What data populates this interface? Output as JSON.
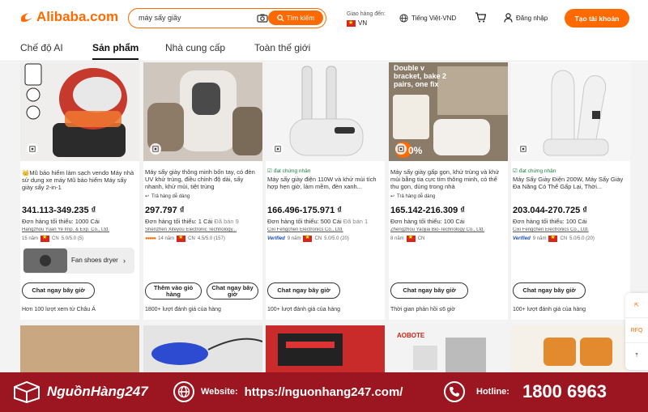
{
  "header": {
    "logo_text": "Alibaba.com",
    "search_query": "máy sấy giầy",
    "search_button": "Tìm kiếm",
    "deliver_to_label": "Giao hàng đến:",
    "deliver_to_country": "VN",
    "language": "Tiếng Việt-VND",
    "login": "Đăng nhập",
    "signup": "Tạo tài khoản"
  },
  "tabs": [
    "Chế độ AI",
    "Sản phẩm",
    "Nhà cung cấp",
    "Toàn thế giới"
  ],
  "products": [
    {
      "title": "👑Mũ bảo hiểm làm sạch vendo Máy nhà sử dụng xe máy Mũ bảo hiểm Máy sấy giày sấy 2-in-1",
      "price": "341.113-349.235 ₫",
      "moq": "Đơn hàng tối thiểu: 1000 Cái",
      "moq_sold": "",
      "supplier": "Hangzhou Yuan Ye Imp. & Exp. Co., Ltd.",
      "meta": "15 năm",
      "country": "CN",
      "rating": "5.0/5.0 (5)",
      "promo_title": "Fan shoes dryer",
      "chat": "Chat ngay bây giờ",
      "footer": "Hơn 100 lượt xem từ Châu Á"
    },
    {
      "title": "Máy sấy giày thông minh bốn tay, có đèn UV khử trùng, điều chỉnh độ dài, sấy nhanh, khử mùi, tiệt trùng",
      "feature": "Trả hàng dễ dàng",
      "price": "297.797 ₫",
      "moq": "Đơn hàng tối thiểu: 1 Cái",
      "moq_sold": "Đã bán 9",
      "supplier": "Shenzhen Xiteyou Electronic Technology...",
      "meta": "14 năm",
      "country": "CN",
      "rating": "4.5/5.0 (157)",
      "action1": "Thêm vào giỏ hàng",
      "action2": "Chat ngay bây giờ",
      "footer": "1800+ lượt đánh giá của hàng"
    },
    {
      "badge": "đạt chứng nhận",
      "title": "Máy sấy giày điện 110W và khử mùi tích hợp hẹn giờ, làm mềm, đèn xanh...",
      "price": "166.496-175.971 ₫",
      "moq": "Đơn hàng tối thiểu: 500 Cái",
      "moq_sold": "Đã bán 1",
      "supplier": "Cixi Fengchen Electronics Co., Ltd.",
      "verified": "Verified",
      "meta": "9 năm",
      "country": "CN",
      "rating": "5.0/5.0 (20)",
      "chat": "Chat ngay bây giờ",
      "footer": "100+ lượt đánh giá của hàng"
    },
    {
      "image_text": "Double v bracket, bake 2 pairs, one fix",
      "discount": "0%",
      "title": "Máy sấy giày gấp gọn, khử trùng và khử mùi bằng tia cực tím thông minh, có thể thu gọn, dùng trong nhà",
      "feature": "Trả hàng dễ dàng",
      "price": "165.142-216.309 ₫",
      "moq": "Đơn hàng tối thiểu: 100 Cái",
      "moq_sold": "",
      "supplier": "Zhengzhou Yaojiai Bio-Technology Co., Ltd.",
      "meta": "8 năm",
      "country": "CN",
      "rating": "",
      "chat": "Chat ngay bây giờ",
      "footer": "Thời gian phản hồi ≤6 giờ"
    },
    {
      "badge": "đạt chứng nhận",
      "title": "Máy Sấy Giày Điện 200W, Máy Sấy Giày Đa Năng Có Thể Gấp Lại, Thời...",
      "price": "203.044-270.725 ₫",
      "moq": "Đơn hàng tối thiểu: 100 Cái",
      "moq_sold": "",
      "supplier": "Cixi Fengchen Electronics Co., Ltd.",
      "verified": "Verified",
      "meta": "9 năm",
      "country": "CN",
      "rating": "5.0/5.0 (20)",
      "chat": "Chat ngay bây giờ",
      "footer": "100+ lượt đánh giá của hàng"
    }
  ],
  "row2": {
    "brand_text": "AOBOTE"
  },
  "side_buttons": [
    "arrow-out-icon",
    "RFQ",
    "top-arrow-icon"
  ],
  "banner": {
    "brand": "NguồnHàng247",
    "website_label": "Website:",
    "website": "https://nguonhang247.com/",
    "hotline_label": "Hotline:",
    "hotline": "1800 6963"
  },
  "colors": {
    "accent": "#ff6a00",
    "banner": "#9b1620"
  }
}
